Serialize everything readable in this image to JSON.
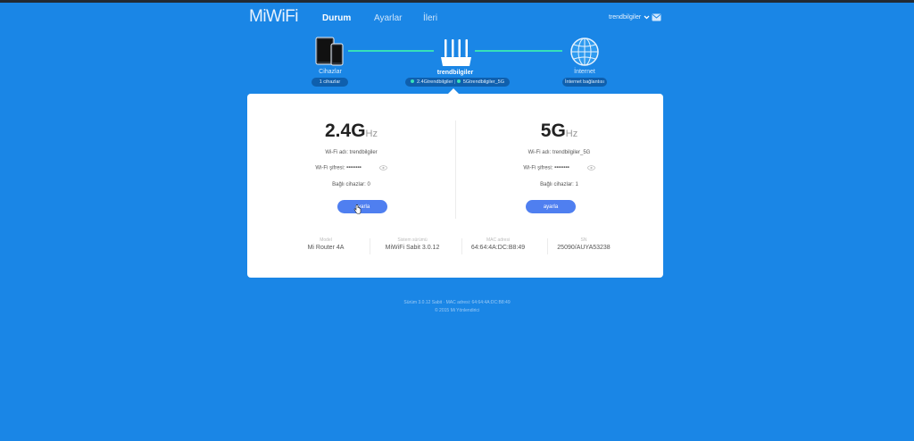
{
  "header": {
    "logo": "MiWiFi",
    "nav": [
      {
        "label": "Durum",
        "active": true
      },
      {
        "label": "Ayarlar",
        "active": false
      },
      {
        "label": "İleri",
        "active": false
      }
    ],
    "user": "trendbilgiler"
  },
  "topology": {
    "devices": {
      "label": "Cihazlar",
      "badge": "1 cihazlar"
    },
    "router": {
      "name": "trendbilgiler",
      "ssid_24": "2.4Gtrendbilgiler",
      "ssid_5": "5Gtrendbilgiler_5G"
    },
    "internet": {
      "label": "İnternet",
      "badge": "İnternet bağlantısı"
    }
  },
  "bands": [
    {
      "main": "2.4G",
      "unit": "Hz",
      "ssid_label": "Wi-Fi adı:",
      "ssid_value": "trendbilgiler",
      "pass_label": "Wi-Fi şifresi:",
      "pass_value": "••••••••",
      "count_label": "Bağlı cihazlar:",
      "count_value": "0",
      "button": "ayarla"
    },
    {
      "main": "5G",
      "unit": "Hz",
      "ssid_label": "Wi-Fi adı:",
      "ssid_value": "trendbilgiler_5G",
      "pass_label": "Wi-Fi şifresi:",
      "pass_value": "••••••••",
      "count_label": "Bağlı cihazlar:",
      "count_value": "1",
      "button": "ayarla"
    }
  ],
  "info": [
    {
      "label": "Model",
      "value": "Mi Router 4A"
    },
    {
      "label": "Sistem sürümü",
      "value": "MiWiFi Sabit 3.0.12"
    },
    {
      "label": "MAC adresi",
      "value": "64:64:4A:DC:B8:49"
    },
    {
      "label": "SN",
      "value": "25090/AUYA53238"
    }
  ],
  "footer": {
    "line1": "Sürüm 3.0.12 Sabit · MAC adresi: 64:64:4A:DC:B8:49",
    "line2": "© 2015 Mi Yönlendirici"
  },
  "colors": {
    "background": "#1a86e6",
    "accent": "#4f7ff0",
    "link_line": "#36e0b9"
  }
}
